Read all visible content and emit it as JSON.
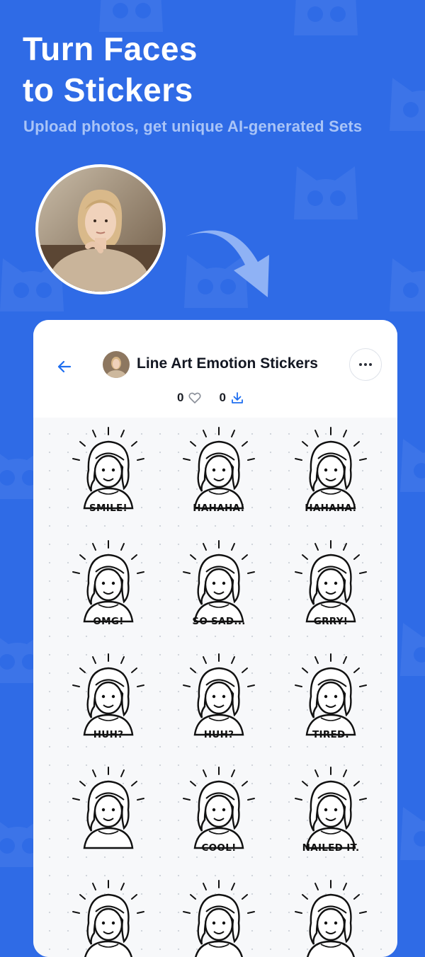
{
  "hero": {
    "title": "Turn Faces\nto Stickers",
    "subtitle": "Upload photos, get unique AI-generated Sets"
  },
  "set": {
    "title": "Line Art Emotion Stickers",
    "likes": "0",
    "downloads": "0"
  },
  "icons": {
    "back": "arrow-left-icon",
    "more": "more-horizontal-icon",
    "like": "heart-icon",
    "download": "download-icon"
  },
  "colors": {
    "background": "#2f6be6",
    "accent": "#1e6ef0",
    "card": "#ffffff"
  },
  "stickers": [
    {
      "label": "SMILE!"
    },
    {
      "label": "HAHAHA!"
    },
    {
      "label": "HAHAHA!"
    },
    {
      "label": "OMG!"
    },
    {
      "label": "SO SAD..."
    },
    {
      "label": "GRRY!"
    },
    {
      "label": "HUH?"
    },
    {
      "label": "HUH?"
    },
    {
      "label": "TIRED."
    },
    {
      "label": ""
    },
    {
      "label": "COOL!"
    },
    {
      "label": "NAILED IT."
    }
  ]
}
